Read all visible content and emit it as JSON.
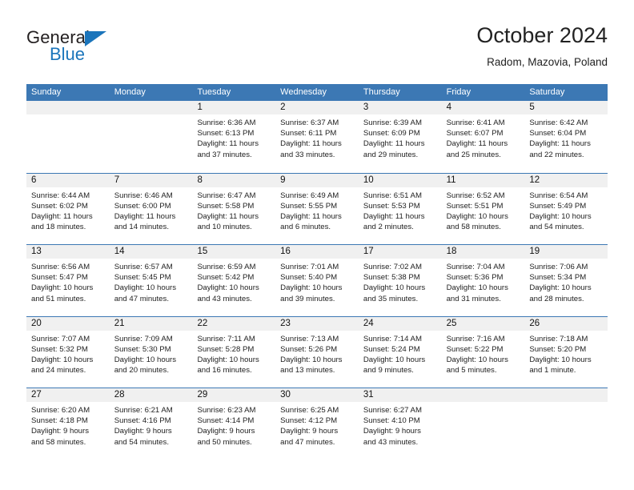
{
  "brand": {
    "name_top": "General",
    "name_bottom": "Blue"
  },
  "header": {
    "title": "October 2024",
    "subtitle": "Radom, Mazovia, Poland"
  },
  "colors": {
    "header_band": "#3c78b4",
    "day_number_band": "#f0f0f0",
    "brand_blue": "#1b75bb",
    "text": "#222222"
  },
  "weekdays": [
    "Sunday",
    "Monday",
    "Tuesday",
    "Wednesday",
    "Thursday",
    "Friday",
    "Saturday"
  ],
  "weeks": [
    [
      {
        "day": "",
        "sunrise": "",
        "sunset": "",
        "daylight1": "",
        "daylight2": ""
      },
      {
        "day": "",
        "sunrise": "",
        "sunset": "",
        "daylight1": "",
        "daylight2": ""
      },
      {
        "day": "1",
        "sunrise": "Sunrise: 6:36 AM",
        "sunset": "Sunset: 6:13 PM",
        "daylight1": "Daylight: 11 hours",
        "daylight2": "and 37 minutes."
      },
      {
        "day": "2",
        "sunrise": "Sunrise: 6:37 AM",
        "sunset": "Sunset: 6:11 PM",
        "daylight1": "Daylight: 11 hours",
        "daylight2": "and 33 minutes."
      },
      {
        "day": "3",
        "sunrise": "Sunrise: 6:39 AM",
        "sunset": "Sunset: 6:09 PM",
        "daylight1": "Daylight: 11 hours",
        "daylight2": "and 29 minutes."
      },
      {
        "day": "4",
        "sunrise": "Sunrise: 6:41 AM",
        "sunset": "Sunset: 6:07 PM",
        "daylight1": "Daylight: 11 hours",
        "daylight2": "and 25 minutes."
      },
      {
        "day": "5",
        "sunrise": "Sunrise: 6:42 AM",
        "sunset": "Sunset: 6:04 PM",
        "daylight1": "Daylight: 11 hours",
        "daylight2": "and 22 minutes."
      }
    ],
    [
      {
        "day": "6",
        "sunrise": "Sunrise: 6:44 AM",
        "sunset": "Sunset: 6:02 PM",
        "daylight1": "Daylight: 11 hours",
        "daylight2": "and 18 minutes."
      },
      {
        "day": "7",
        "sunrise": "Sunrise: 6:46 AM",
        "sunset": "Sunset: 6:00 PM",
        "daylight1": "Daylight: 11 hours",
        "daylight2": "and 14 minutes."
      },
      {
        "day": "8",
        "sunrise": "Sunrise: 6:47 AM",
        "sunset": "Sunset: 5:58 PM",
        "daylight1": "Daylight: 11 hours",
        "daylight2": "and 10 minutes."
      },
      {
        "day": "9",
        "sunrise": "Sunrise: 6:49 AM",
        "sunset": "Sunset: 5:55 PM",
        "daylight1": "Daylight: 11 hours",
        "daylight2": "and 6 minutes."
      },
      {
        "day": "10",
        "sunrise": "Sunrise: 6:51 AM",
        "sunset": "Sunset: 5:53 PM",
        "daylight1": "Daylight: 11 hours",
        "daylight2": "and 2 minutes."
      },
      {
        "day": "11",
        "sunrise": "Sunrise: 6:52 AM",
        "sunset": "Sunset: 5:51 PM",
        "daylight1": "Daylight: 10 hours",
        "daylight2": "and 58 minutes."
      },
      {
        "day": "12",
        "sunrise": "Sunrise: 6:54 AM",
        "sunset": "Sunset: 5:49 PM",
        "daylight1": "Daylight: 10 hours",
        "daylight2": "and 54 minutes."
      }
    ],
    [
      {
        "day": "13",
        "sunrise": "Sunrise: 6:56 AM",
        "sunset": "Sunset: 5:47 PM",
        "daylight1": "Daylight: 10 hours",
        "daylight2": "and 51 minutes."
      },
      {
        "day": "14",
        "sunrise": "Sunrise: 6:57 AM",
        "sunset": "Sunset: 5:45 PM",
        "daylight1": "Daylight: 10 hours",
        "daylight2": "and 47 minutes."
      },
      {
        "day": "15",
        "sunrise": "Sunrise: 6:59 AM",
        "sunset": "Sunset: 5:42 PM",
        "daylight1": "Daylight: 10 hours",
        "daylight2": "and 43 minutes."
      },
      {
        "day": "16",
        "sunrise": "Sunrise: 7:01 AM",
        "sunset": "Sunset: 5:40 PM",
        "daylight1": "Daylight: 10 hours",
        "daylight2": "and 39 minutes."
      },
      {
        "day": "17",
        "sunrise": "Sunrise: 7:02 AM",
        "sunset": "Sunset: 5:38 PM",
        "daylight1": "Daylight: 10 hours",
        "daylight2": "and 35 minutes."
      },
      {
        "day": "18",
        "sunrise": "Sunrise: 7:04 AM",
        "sunset": "Sunset: 5:36 PM",
        "daylight1": "Daylight: 10 hours",
        "daylight2": "and 31 minutes."
      },
      {
        "day": "19",
        "sunrise": "Sunrise: 7:06 AM",
        "sunset": "Sunset: 5:34 PM",
        "daylight1": "Daylight: 10 hours",
        "daylight2": "and 28 minutes."
      }
    ],
    [
      {
        "day": "20",
        "sunrise": "Sunrise: 7:07 AM",
        "sunset": "Sunset: 5:32 PM",
        "daylight1": "Daylight: 10 hours",
        "daylight2": "and 24 minutes."
      },
      {
        "day": "21",
        "sunrise": "Sunrise: 7:09 AM",
        "sunset": "Sunset: 5:30 PM",
        "daylight1": "Daylight: 10 hours",
        "daylight2": "and 20 minutes."
      },
      {
        "day": "22",
        "sunrise": "Sunrise: 7:11 AM",
        "sunset": "Sunset: 5:28 PM",
        "daylight1": "Daylight: 10 hours",
        "daylight2": "and 16 minutes."
      },
      {
        "day": "23",
        "sunrise": "Sunrise: 7:13 AM",
        "sunset": "Sunset: 5:26 PM",
        "daylight1": "Daylight: 10 hours",
        "daylight2": "and 13 minutes."
      },
      {
        "day": "24",
        "sunrise": "Sunrise: 7:14 AM",
        "sunset": "Sunset: 5:24 PM",
        "daylight1": "Daylight: 10 hours",
        "daylight2": "and 9 minutes."
      },
      {
        "day": "25",
        "sunrise": "Sunrise: 7:16 AM",
        "sunset": "Sunset: 5:22 PM",
        "daylight1": "Daylight: 10 hours",
        "daylight2": "and 5 minutes."
      },
      {
        "day": "26",
        "sunrise": "Sunrise: 7:18 AM",
        "sunset": "Sunset: 5:20 PM",
        "daylight1": "Daylight: 10 hours",
        "daylight2": "and 1 minute."
      }
    ],
    [
      {
        "day": "27",
        "sunrise": "Sunrise: 6:20 AM",
        "sunset": "Sunset: 4:18 PM",
        "daylight1": "Daylight: 9 hours",
        "daylight2": "and 58 minutes."
      },
      {
        "day": "28",
        "sunrise": "Sunrise: 6:21 AM",
        "sunset": "Sunset: 4:16 PM",
        "daylight1": "Daylight: 9 hours",
        "daylight2": "and 54 minutes."
      },
      {
        "day": "29",
        "sunrise": "Sunrise: 6:23 AM",
        "sunset": "Sunset: 4:14 PM",
        "daylight1": "Daylight: 9 hours",
        "daylight2": "and 50 minutes."
      },
      {
        "day": "30",
        "sunrise": "Sunrise: 6:25 AM",
        "sunset": "Sunset: 4:12 PM",
        "daylight1": "Daylight: 9 hours",
        "daylight2": "and 47 minutes."
      },
      {
        "day": "31",
        "sunrise": "Sunrise: 6:27 AM",
        "sunset": "Sunset: 4:10 PM",
        "daylight1": "Daylight: 9 hours",
        "daylight2": "and 43 minutes."
      },
      {
        "day": "",
        "sunrise": "",
        "sunset": "",
        "daylight1": "",
        "daylight2": ""
      },
      {
        "day": "",
        "sunrise": "",
        "sunset": "",
        "daylight1": "",
        "daylight2": ""
      }
    ]
  ]
}
